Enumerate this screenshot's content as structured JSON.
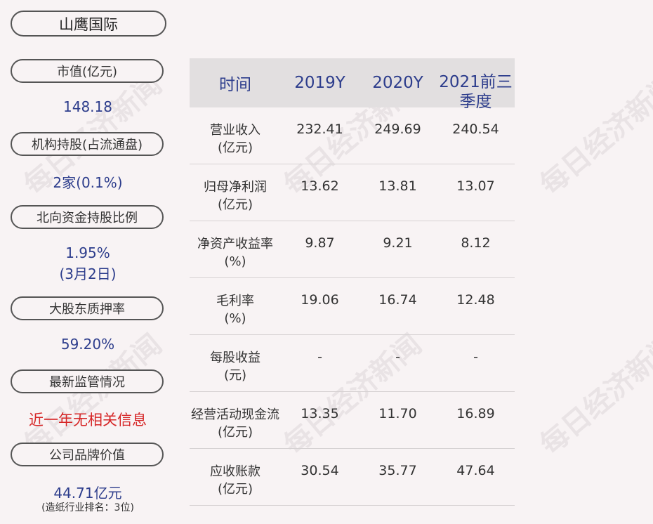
{
  "company": "山鹰国际",
  "left_panel": [
    {
      "label": "市值(亿元)",
      "value": "148.18"
    },
    {
      "label": "机构持股(占流通盘)",
      "value": "2家(0.1%)"
    },
    {
      "label": "北向资金持股比例",
      "value_line1": "1.95%",
      "value_line2": "(3月2日)"
    },
    {
      "label": "大股东质押率",
      "value": "59.20%"
    },
    {
      "label": "最新监管情况",
      "value": "近一年无相关信息"
    },
    {
      "label": "公司品牌价值",
      "value": "44.71亿元",
      "note": "(造纸行业排名：3位)"
    }
  ],
  "table": {
    "headers": [
      "时间",
      "2019Y",
      "2020Y",
      "2021前三季度"
    ],
    "rows": [
      {
        "label": "营业收入\n(亿元)",
        "values": [
          "232.41",
          "249.69",
          "240.54"
        ]
      },
      {
        "label": "归母净利润\n(亿元)",
        "values": [
          "13.62",
          "13.81",
          "13.07"
        ]
      },
      {
        "label": "净资产收益率\n(%)",
        "values": [
          "9.87",
          "9.21",
          "8.12"
        ]
      },
      {
        "label": "毛利率\n(%)",
        "values": [
          "19.06",
          "16.74",
          "12.48"
        ]
      },
      {
        "label": "每股收益\n(元)",
        "values": [
          "-",
          "-",
          "-"
        ]
      },
      {
        "label": "经营活动现金流\n(亿元)",
        "values": [
          "13.35",
          "11.70",
          "16.89"
        ]
      },
      {
        "label": "应收账款\n(亿元)",
        "values": [
          "30.54",
          "35.77",
          "47.64"
        ]
      }
    ]
  },
  "watermark": "每日经济新闻",
  "colors": {
    "value_blue": "#2d3d8c",
    "alert_red": "#d62728",
    "header_bg": "#e2dfe0"
  }
}
